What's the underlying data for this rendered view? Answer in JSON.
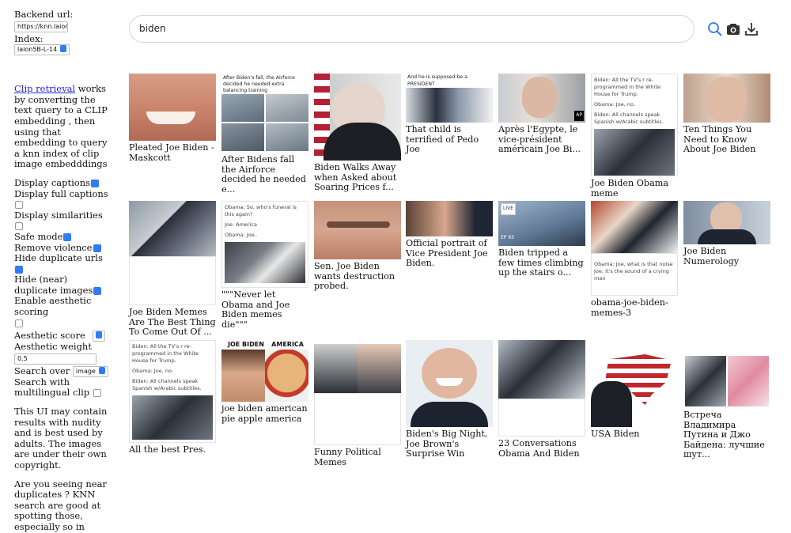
{
  "sidebar": {
    "backend_label": "Backend url:",
    "backend_value": "https://knn.laion",
    "index_label": "Index:",
    "index_value": "laion5B-L-14",
    "intro_link": "Clip retrieval",
    "intro_rest": " works by converting the text query to a CLIP embedding , then using that embedding to query a knn index of clip image embedddings",
    "options": [
      {
        "label": "Display captions",
        "checked": true
      },
      {
        "label": "Display full captions",
        "checked": false
      },
      {
        "label": "Display similarities",
        "checked": false
      },
      {
        "label": "Safe mode",
        "checked": true
      },
      {
        "label": "Remove violence",
        "checked": true
      },
      {
        "label": "Hide duplicate urls",
        "checked": true
      },
      {
        "label": "Hide (near) duplicate images",
        "checked": true
      },
      {
        "label": "Enable aesthetic scoring",
        "checked": false
      }
    ],
    "aesthetic_score_label": "Aesthetic score",
    "aesthetic_weight_label": "Aesthetic weight",
    "aesthetic_weight_value": "0.5",
    "search_over_label": "Search over",
    "search_over_value": "image",
    "multilingual_label": "Search with multilingual clip",
    "warning": "This UI may contain results with nudity and is best used by adults. The images are under their own copyright.",
    "duplicates_note": "Are you seeing near duplicates ? KNN search are good at spotting those, especially so in"
  },
  "search": {
    "query": "biden"
  },
  "colors": {
    "accent": "#2f7cf6",
    "link": "#2424d6"
  },
  "icons": {
    "search": "magnifier-icon",
    "camera": "camera-icon",
    "download": "download-icon"
  },
  "texts": {
    "c2_top": "After Biden's fall, the Airforce decided he needed extra balancing training",
    "c4_top": "And he is supposed be a PRESIDENT",
    "c6_t1": "Biden: All the TV's r re-programmed in the White House for Trump.",
    "c6_t2": "Obama: Joe, no.",
    "c6_t3": "Biden: All channels speak Spanish w/Arabic subtitles.",
    "c9_t1": "Obama: So, who's funeral is this again?",
    "c9_t2": "Joe: America",
    "c9_t3": "Obama: Joe..",
    "live": "LIVE",
    "ep": "EP 93",
    "c15_t1": "Obama: Joe, what is that noise",
    "c15_t2": "Joe: It's the sound of a crying man",
    "sign_left": "JOE BIDEN",
    "sign_right": "AMERICA",
    "ap": "AP"
  },
  "captions": {
    "c1": "Pleated Joe Biden - Maskcott",
    "c2": "After Bidens fall the Airforce decided he needed e...",
    "c3": "Biden Walks Away when Asked about Soaring Prices f...",
    "c4": "That child is terrified of Pedo Joe",
    "c5": "Après l'Egypte, le vice-président américain Joe Bi...",
    "c6": "Joe Biden Obama meme",
    "c7": "Ten Things You Need to Know About Joe Biden",
    "c8": "Joe Biden Memes Are The Best Thing To Come Out Of ...",
    "c9": "\"\"\"Never let Obama and Joe Biden memes die\"\"\"",
    "c10": "Sen. Joe Biden wants destruction probed.",
    "c11": "Official portrait of Vice President Joe Biden.",
    "c12": "Biden tripped a few times climbing up the stairs o...",
    "c13": "obama-joe-biden-memes-3",
    "c14": "Joe Biden Numerology",
    "c15": "All the best Pres.",
    "c16": "joe biden american pie apple america",
    "c17": "Funny Political Memes",
    "c18": "Biden's Big Night, Joe Brown's Surprise Win",
    "c19": "23 Conversations Obama And Biden",
    "c20": "USA Biden",
    "c21": "Встреча Владимира Путина и Джо Байдена: лучшие шут..."
  }
}
